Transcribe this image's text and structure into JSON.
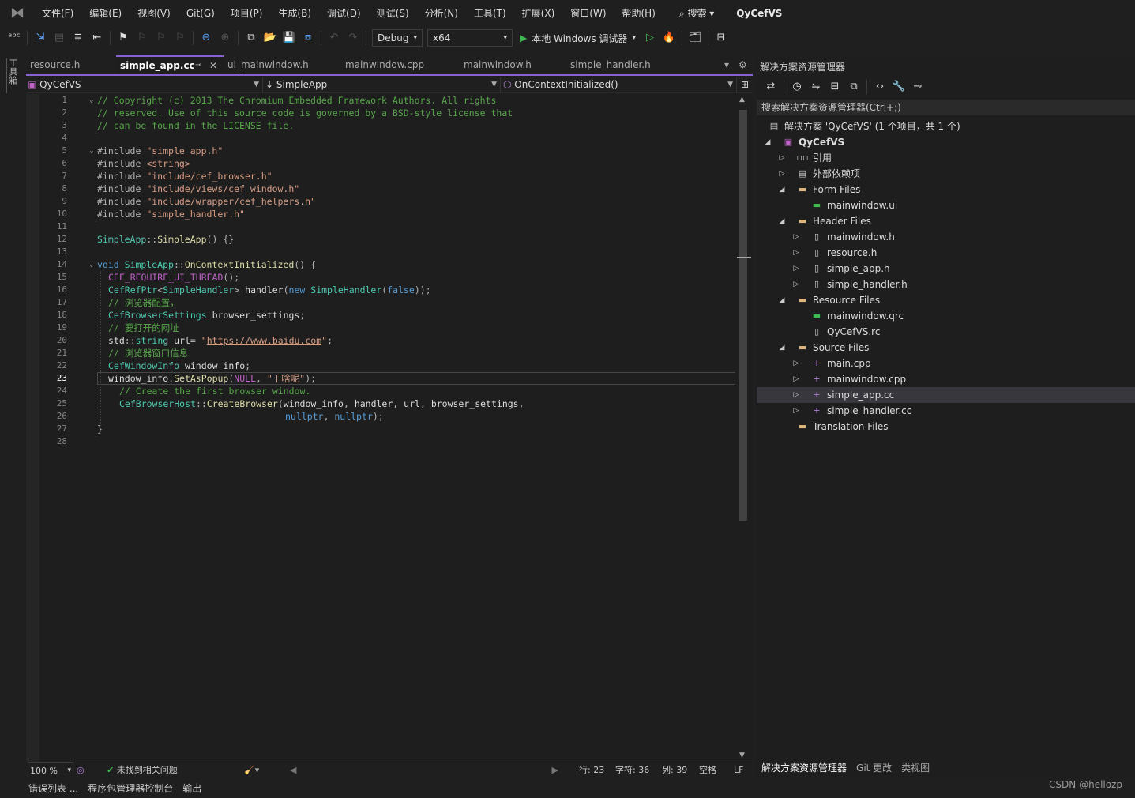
{
  "menu": {
    "items": [
      "文件(F)",
      "编辑(E)",
      "视图(V)",
      "Git(G)",
      "项目(P)",
      "生成(B)",
      "调试(D)",
      "测试(S)",
      "分析(N)",
      "工具(T)",
      "扩展(X)",
      "窗口(W)",
      "帮助(H)"
    ],
    "search_label": "搜索",
    "app_title": "QyCefVS"
  },
  "toolbar": {
    "config": "Debug",
    "platform": "x64",
    "run_label": "本地 Windows 调试器"
  },
  "left_tool": {
    "label": "工具箱"
  },
  "tabs": [
    {
      "label": "resource.h"
    },
    {
      "label": "simple_app.cc",
      "active": true
    },
    {
      "label": "ui_mainwindow.h"
    },
    {
      "label": "mainwindow.cpp"
    },
    {
      "label": "mainwindow.h"
    },
    {
      "label": "simple_handler.h"
    }
  ],
  "navbar": {
    "project": "QyCefVS",
    "scope": "SimpleApp",
    "member": "OnContextInitialized()"
  },
  "code": {
    "current_line": 23,
    "line_numbers": [
      "1",
      "2",
      "3",
      "4",
      "5",
      "6",
      "7",
      "8",
      "9",
      "10",
      "11",
      "12",
      "13",
      "14",
      "15",
      "16",
      "17",
      "18",
      "19",
      "20",
      "21",
      "22",
      "23",
      "24",
      "25",
      "26",
      "27",
      "28"
    ],
    "lines": [
      "// Copyright (c) 2013 The Chromium Embedded Framework Authors. All rights",
      "// reserved. Use of this source code is governed by a BSD-style license that",
      "// can be found in the LICENSE file.",
      "",
      "#include \"simple_app.h\"",
      "#include <string>",
      "#include \"include/cef_browser.h\"",
      "#include \"include/views/cef_window.h\"",
      "#include \"include/wrapper/cef_helpers.h\"",
      "#include \"simple_handler.h\"",
      "",
      "SimpleApp::SimpleApp() {}",
      "",
      "void SimpleApp::OnContextInitialized() {",
      "CEF_REQUIRE_UI_THREAD();",
      "CefRefPtr<SimpleHandler> handler(new SimpleHandler(false));",
      "// 浏览器配置，",
      "CefBrowserSettings browser_settings;",
      "// 要打开的网址",
      "std::string url= \"https://www.baidu.com\";",
      "// 浏览器窗口信息",
      "CefWindowInfo window_info;",
      "window_info.SetAsPopup(NULL, \"干啥呢\");",
      "// Create the first browser window.",
      "CefBrowserHost::CreateBrowser(window_info, handler, url, browser_settings,",
      "nullptr, nullptr);",
      "}",
      ""
    ]
  },
  "status": {
    "zoom": "100 %",
    "issues": "未找到相关问题",
    "line": "行: 23",
    "char": "字符: 36",
    "col": "列: 39",
    "indent": "空格",
    "eol": "LF"
  },
  "bottom_tabs": [
    "错误列表 ...",
    "程序包管理器控制台",
    "输出"
  ],
  "solution_explorer": {
    "title": "解决方案资源管理器",
    "search_placeholder": "搜索解决方案资源管理器(Ctrl+;)",
    "solution_label": "解决方案 'QyCefVS' (1 个项目，共 1 个)",
    "project": "QyCefVS",
    "nodes": [
      {
        "label": "引用",
        "icon": "reference-icon"
      },
      {
        "label": "外部依赖项",
        "icon": "external-deps-icon"
      },
      {
        "label": "Form Files",
        "icon": "filter-folder-icon"
      },
      {
        "label": "mainwindow.ui",
        "icon": "ui-file-icon"
      },
      {
        "label": "Header Files",
        "icon": "filter-folder-icon"
      },
      {
        "label": "mainwindow.h",
        "icon": "header-file-icon"
      },
      {
        "label": "resource.h",
        "icon": "header-file-icon"
      },
      {
        "label": "simple_app.h",
        "icon": "header-file-icon"
      },
      {
        "label": "simple_handler.h",
        "icon": "header-file-icon"
      },
      {
        "label": "Resource Files",
        "icon": "filter-folder-icon"
      },
      {
        "label": "mainwindow.qrc",
        "icon": "qrc-file-icon"
      },
      {
        "label": "QyCefVS.rc",
        "icon": "rc-file-icon"
      },
      {
        "label": "Source Files",
        "icon": "filter-folder-icon"
      },
      {
        "label": "main.cpp",
        "icon": "cpp-file-icon"
      },
      {
        "label": "mainwindow.cpp",
        "icon": "cpp-file-icon"
      },
      {
        "label": "simple_app.cc",
        "icon": "cpp-file-icon",
        "selected": true
      },
      {
        "label": "simple_handler.cc",
        "icon": "cpp-file-icon"
      },
      {
        "label": "Translation Files",
        "icon": "filter-folder-icon"
      }
    ],
    "bottom_tabs": [
      "解决方案资源管理器",
      "Git 更改",
      "类视图"
    ]
  },
  "watermark": "CSDN @hellozp",
  "colors": {
    "accent": "#8a63d2",
    "comment": "#57a64a",
    "keyword": "#569cd6",
    "string": "#d69d85",
    "type": "#4ec9b0",
    "function": "#dcdcaa",
    "macro": "#bd63c5"
  }
}
